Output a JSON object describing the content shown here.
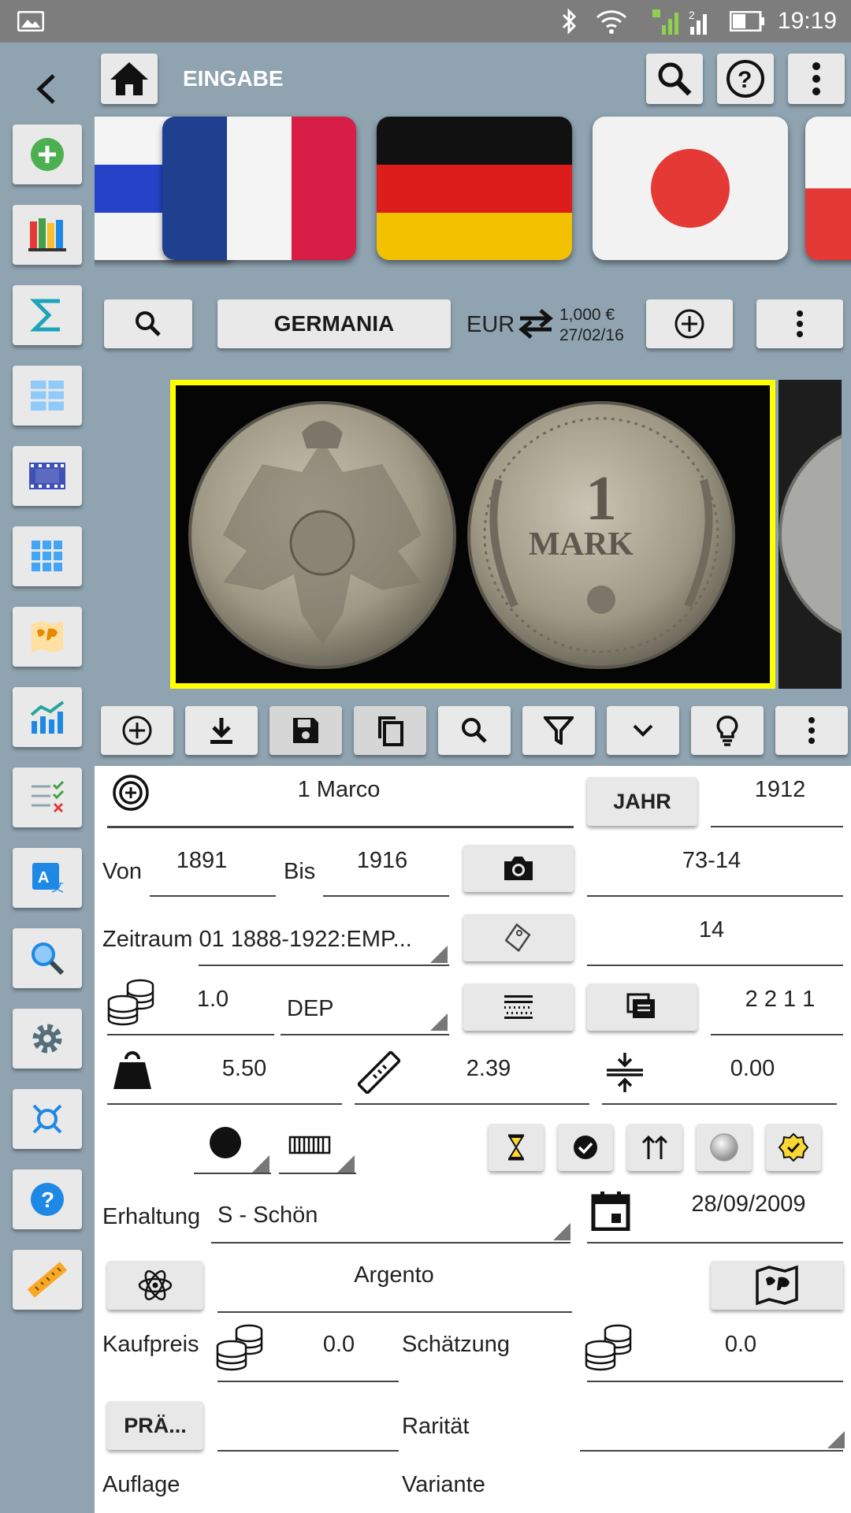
{
  "status_bar": {
    "time": "19:19"
  },
  "app_bar": {
    "title": "EINGABE"
  },
  "country_bar": {
    "country": "GERMANIA",
    "currency": "EUR",
    "rate": "1,000 €",
    "rate_date": "27/02/16"
  },
  "coin": {
    "name": "1 Marco",
    "year_button": "JAHR",
    "year": "1912",
    "from_label": "Von",
    "from": "1891",
    "to_label": "Bis",
    "to": "1916",
    "catalog": "73-14",
    "period": "Zeitraum 01 1888-1922:EMP...",
    "tag_value": "14",
    "denomination_value": "1.0",
    "location": "DEP",
    "quantity": "2 2 1 1",
    "weight": "5.50",
    "diameter": "2.39",
    "thickness": "0.00",
    "condition_label": "Erhaltung",
    "condition": "S - Schön",
    "date": "28/09/2009",
    "metal": "Argento",
    "purchase_label": "Kaufpreis",
    "purchase": "0.0",
    "estimate_label": "Schätzung",
    "estimate": "0.0",
    "mint_button": "PRÄ...",
    "rarity_label": "Rarität",
    "mintage_label": "Auflage",
    "variant_label": "Variante"
  },
  "colors": {
    "background": "#8fa3b0",
    "button": "#e9e9e9",
    "highlight": "#ffff00",
    "green": "#4caf50",
    "blue": "#1e88e5"
  }
}
